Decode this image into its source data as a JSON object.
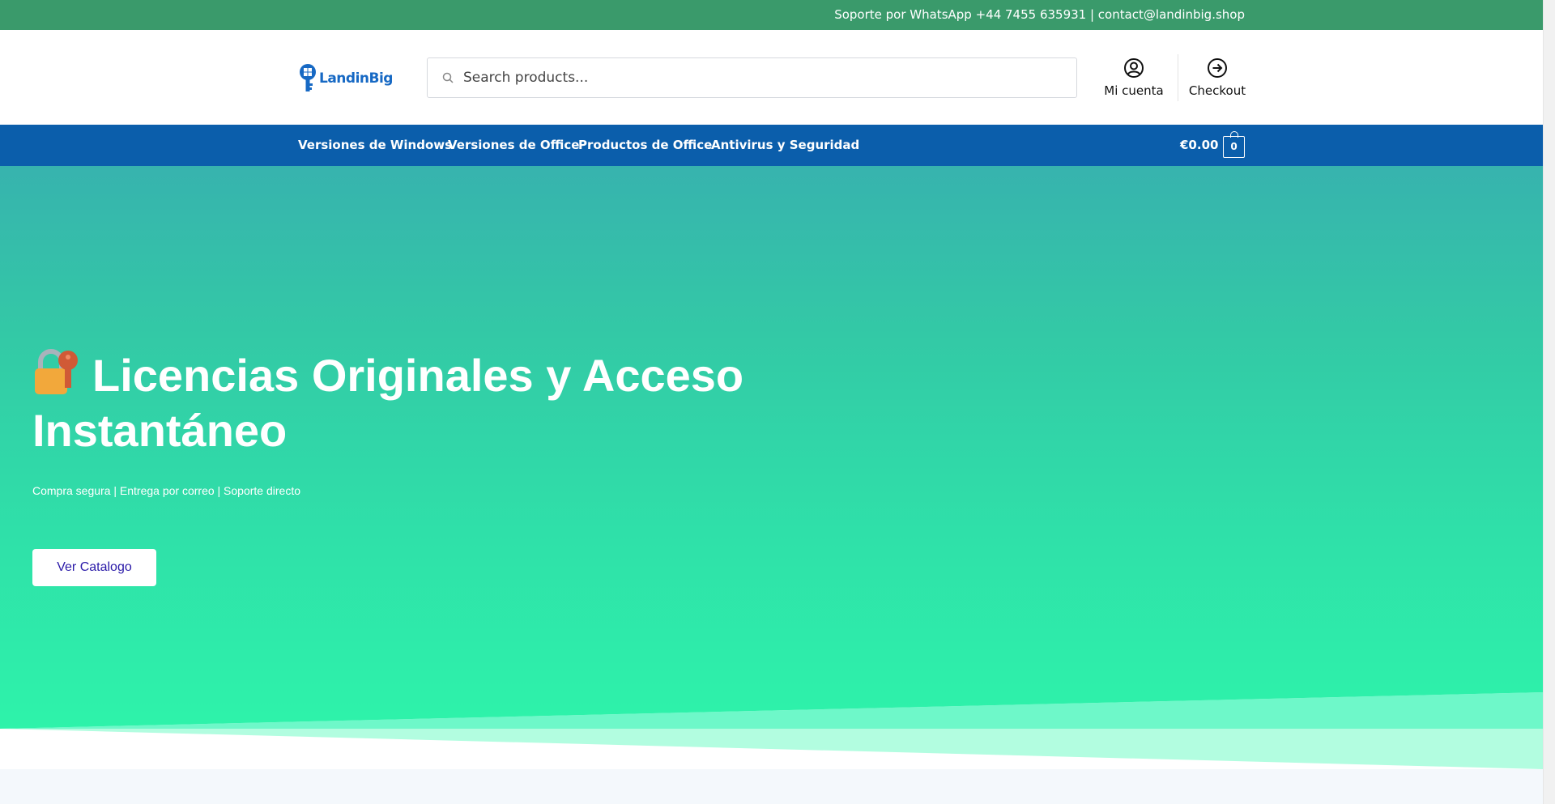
{
  "topbar": {
    "contact": "Soporte por WhatsApp +44 7455 635931 | contact@landinbig.shop",
    "color": "#3a9a6b"
  },
  "header": {
    "logo_text": "LandinBig",
    "search_placeholder": "Search products...",
    "account_label": "Mi cuenta",
    "checkout_label": "Checkout"
  },
  "nav": {
    "color": "#0b5eab",
    "items": [
      {
        "label": "Versiones de Windows"
      },
      {
        "label": "Versiones de Office"
      },
      {
        "label": "Productos de Office"
      },
      {
        "label": "Antivirus y Seguridad"
      }
    ],
    "cart_amount": "€0.00",
    "cart_count": "0"
  },
  "hero": {
    "title": "Licencias Originales y Acceso Instantáneo",
    "subtitle": "Compra segura | Entrega por correo | Soporte directo",
    "button_label": "Ver Catalogo",
    "icon": "locked-with-key-icon",
    "gradient": [
      "#37b3ae",
      "#2ef3aa"
    ]
  }
}
